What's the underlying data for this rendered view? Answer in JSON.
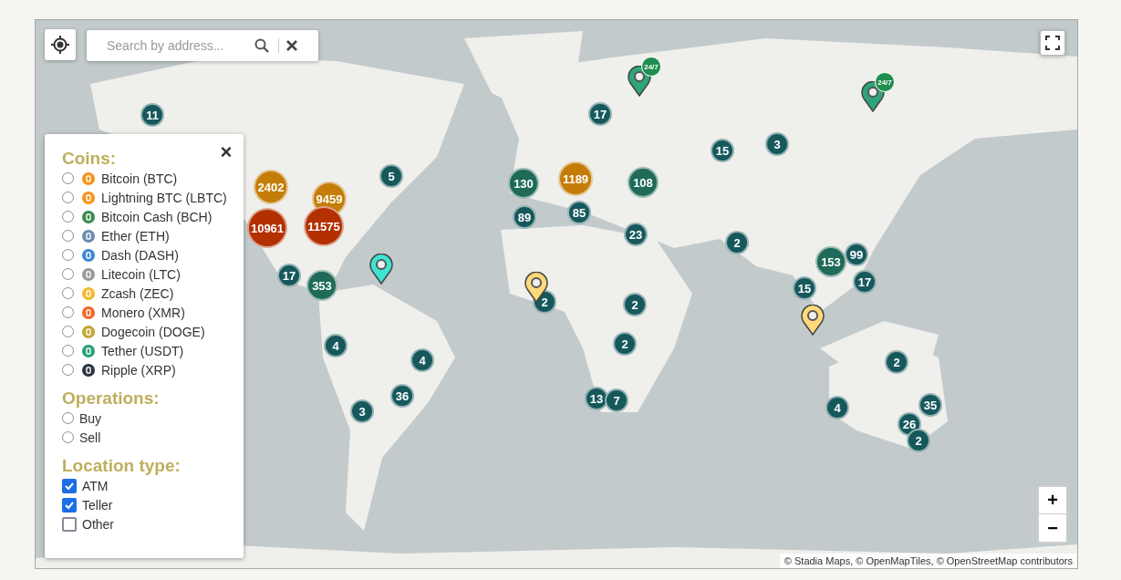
{
  "search": {
    "placeholder": "Search by address..."
  },
  "filters": {
    "sections": [
      {
        "title": "Coins:",
        "kind": "radio",
        "items": [
          {
            "label": "Bitcoin (BTC)",
            "selected": false,
            "color": "#f7931a"
          },
          {
            "label": "Lightning BTC (LBTC)",
            "selected": false,
            "color": "#f7931a"
          },
          {
            "label": "Bitcoin Cash (BCH)",
            "selected": false,
            "color": "#3b8a4f"
          },
          {
            "label": "Ether (ETH)",
            "selected": false,
            "color": "#6b8cae"
          },
          {
            "label": "Dash (DASH)",
            "selected": false,
            "color": "#3c87d6"
          },
          {
            "label": "Litecoin (LTC)",
            "selected": false,
            "color": "#999999"
          },
          {
            "label": "Zcash (ZEC)",
            "selected": false,
            "color": "#f4b728"
          },
          {
            "label": "Monero (XMR)",
            "selected": false,
            "color": "#f26822"
          },
          {
            "label": "Dogecoin (DOGE)",
            "selected": false,
            "color": "#c2a633"
          },
          {
            "label": "Tether (USDT)",
            "selected": false,
            "color": "#26a17b"
          },
          {
            "label": "Ripple (XRP)",
            "selected": false,
            "color": "#2b3440"
          }
        ]
      },
      {
        "title": "Operations:",
        "kind": "radio",
        "items": [
          {
            "label": "Buy",
            "selected": false
          },
          {
            "label": "Sell",
            "selected": false
          }
        ]
      },
      {
        "title": "Location type:",
        "kind": "checkbox",
        "items": [
          {
            "label": "ATM",
            "checked": true
          },
          {
            "label": "Teller",
            "checked": true
          },
          {
            "label": "Other",
            "checked": false
          }
        ]
      }
    ]
  },
  "clusters": [
    {
      "count": "11",
      "color": "#16585c"
    },
    {
      "count": "2402",
      "color": "#c47d08"
    },
    {
      "count": "9459",
      "color": "#c47d08"
    },
    {
      "count": "10961",
      "color": "#b33000"
    },
    {
      "count": "11575",
      "color": "#b33000"
    },
    {
      "count": "5",
      "color": "#16585c"
    },
    {
      "count": "130",
      "color": "#1f6a58"
    },
    {
      "count": "1189",
      "color": "#c47d08"
    },
    {
      "count": "108",
      "color": "#1f6a58"
    },
    {
      "count": "89",
      "color": "#16585c"
    },
    {
      "count": "85",
      "color": "#16585c"
    },
    {
      "count": "17",
      "color": "#16585c"
    },
    {
      "count": "23",
      "color": "#16585c"
    },
    {
      "count": "17",
      "color": "#16585c"
    },
    {
      "count": "353",
      "color": "#1f6a58"
    },
    {
      "count": "2",
      "color": "#16585c"
    },
    {
      "count": "2",
      "color": "#16585c"
    },
    {
      "count": "2",
      "color": "#16585c"
    },
    {
      "count": "4",
      "color": "#16585c"
    },
    {
      "count": "4",
      "color": "#16585c"
    },
    {
      "count": "36",
      "color": "#16585c"
    },
    {
      "count": "3",
      "color": "#16585c"
    },
    {
      "count": "13",
      "color": "#16585c"
    },
    {
      "count": "7",
      "color": "#16585c"
    },
    {
      "count": "15",
      "color": "#16585c"
    },
    {
      "count": "3",
      "color": "#16585c"
    },
    {
      "count": "2",
      "color": "#16585c"
    },
    {
      "count": "99",
      "color": "#16585c"
    },
    {
      "count": "153",
      "color": "#1f6a58"
    },
    {
      "count": "15",
      "color": "#16585c"
    },
    {
      "count": "17",
      "color": "#16585c"
    },
    {
      "count": "2",
      "color": "#16585c"
    },
    {
      "count": "4",
      "color": "#16585c"
    },
    {
      "count": "35",
      "color": "#16585c"
    },
    {
      "count": "26",
      "color": "#16585c"
    },
    {
      "count": "2",
      "color": "#16585c"
    }
  ],
  "pins": [
    {
      "color": "#3de3d3"
    },
    {
      "color": "#ffd97a"
    },
    {
      "color": "#ffd97a"
    },
    {
      "color": "#2ea57a",
      "badge": "24/7"
    },
    {
      "color": "#2ea57a",
      "badge": "24/7"
    }
  ],
  "zoom": {
    "in": "+",
    "out": "−"
  },
  "panel_close": "×",
  "attribution": "© Stadia Maps, © OpenMapTiles, © OpenStreetMap contributors"
}
